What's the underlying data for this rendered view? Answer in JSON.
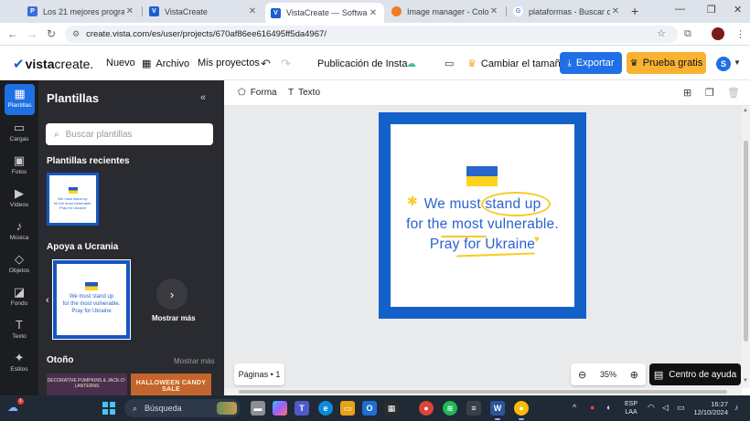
{
  "browser": {
    "tabs": [
      {
        "title": "Los 21 mejores programas d",
        "fav_color": "#3b6fd8",
        "fav_letter": "P"
      },
      {
        "title": "VistaCreate",
        "fav_color": "#1b5fd1",
        "fav_letter": "V"
      },
      {
        "title": "VistaCreate — Software gra",
        "fav_color": "#1b5fd1",
        "fav_letter": "V"
      },
      {
        "title": "Image manager - Colorcinch",
        "fav_color": "#ef7d22",
        "fav_letter": ""
      },
      {
        "title": "plataformas - Buscar con Go",
        "fav_color": "#ffffff",
        "fav_letter": "G"
      }
    ],
    "url": "create.vista.com/es/user/projects/670af86ee616495ff5da4967/"
  },
  "header": {
    "logo_vista": "vista",
    "logo_create": "create.",
    "nav_new": "Nuevo",
    "nav_file": "Archivo",
    "nav_projects": "Mis proyectos",
    "project_title": "Publicación de Insta...",
    "resize_label": "Cambiar el tamaño",
    "export_label": "Exportar",
    "trial_label": "Prueba gratis",
    "avatar_letter": "S"
  },
  "rail": {
    "items": [
      {
        "label": "Plantillas"
      },
      {
        "label": "Cargas"
      },
      {
        "label": "Fotos"
      },
      {
        "label": "Vídeos"
      },
      {
        "label": "Música"
      },
      {
        "label": "Objetos"
      },
      {
        "label": "Fondo"
      },
      {
        "label": "Texto"
      },
      {
        "label": "Estilos"
      }
    ]
  },
  "panel": {
    "title": "Plantillas",
    "search_placeholder": "Buscar plantillas",
    "recent_title": "Plantillas recientes",
    "ukraine_title": "Apoya a Ucrania",
    "show_more": "Mostrar más",
    "autumn_title": "Otoño",
    "autumn_more": "Mostrar más",
    "fall_thumb_1": "DECORATIVE PUMPKINS & JACK-O'-LANTERNS",
    "fall_thumb_2": "HALLOWEEN CANDY SALE"
  },
  "toolbar": {
    "shape_label": "Forma",
    "text_label": "Texto"
  },
  "design": {
    "line1_a": "We must ",
    "line1_b": "stand up",
    "line2": "for the most vulnerable.",
    "line3": "Pray for Ukraine",
    "mini_line1": "We must stand up",
    "mini_line2": "for the most vulnerable.",
    "mini_line3": "Pray for Ukraine",
    "border_color": "#1460c9",
    "text_color": "#2b62cf",
    "accent_color": "#f6cc27"
  },
  "footer": {
    "pages_label": "Páginas • 1",
    "zoom_value": "35%",
    "help_label": "Centro de ayuda"
  },
  "taskbar": {
    "search_label": "Búsqueda",
    "lang": "ESP",
    "lang_region": "LAA",
    "time": "16:27",
    "date": "12/10/2024",
    "weather_badge": "1"
  }
}
